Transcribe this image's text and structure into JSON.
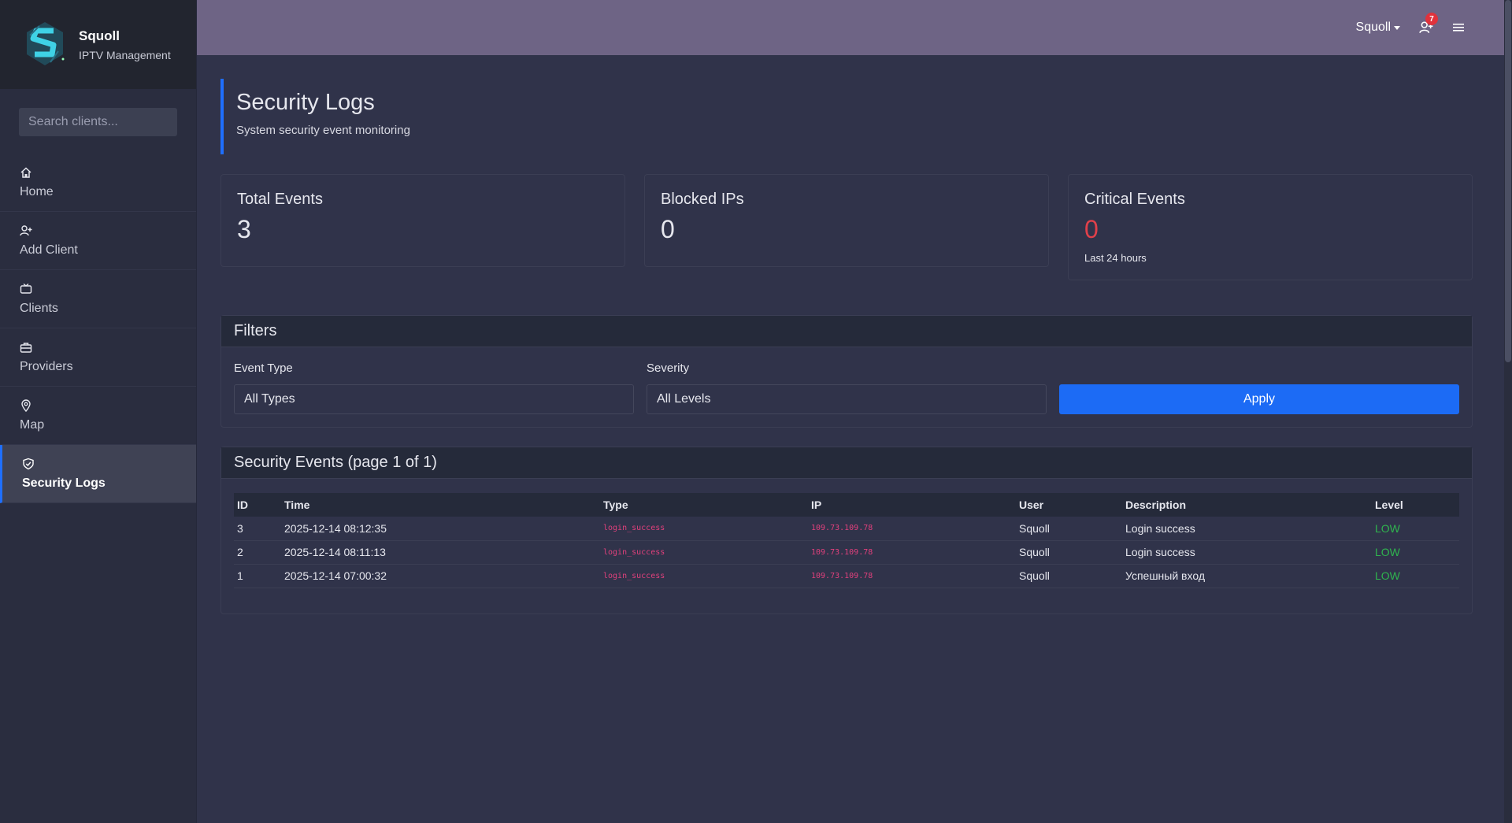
{
  "brand": {
    "name": "Squoll",
    "subtitle": "IPTV Management"
  },
  "sidebar": {
    "search_placeholder": "Search clients...",
    "items": [
      {
        "label": "Home",
        "icon": "home-icon"
      },
      {
        "label": "Add Client",
        "icon": "add-user-icon"
      },
      {
        "label": "Clients",
        "icon": "tv-icon"
      },
      {
        "label": "Providers",
        "icon": "briefcase-icon"
      },
      {
        "label": "Map",
        "icon": "map-pin-icon"
      },
      {
        "label": "Security Logs",
        "icon": "shield-icon",
        "active": true
      }
    ]
  },
  "topbar": {
    "user": "Squoll",
    "notifications": "7"
  },
  "page": {
    "title": "Security Logs",
    "subtitle": "System security event monitoring"
  },
  "stats": {
    "total": {
      "label": "Total Events",
      "value": "3"
    },
    "blocked": {
      "label": "Blocked IPs",
      "value": "0"
    },
    "critical": {
      "label": "Critical Events",
      "value": "0",
      "note": "Last 24 hours"
    }
  },
  "filters": {
    "title": "Filters",
    "event_type_label": "Event Type",
    "event_type_value": "All Types",
    "severity_label": "Severity",
    "severity_value": "All Levels",
    "apply": "Apply"
  },
  "events": {
    "title": "Security Events (page 1 of 1)",
    "columns": [
      "ID",
      "Time",
      "Type",
      "IP",
      "User",
      "Description",
      "Level"
    ],
    "rows": [
      [
        "3",
        "2025-12-14 08:12:35",
        "login_success",
        "109.73.109.78",
        "Squoll",
        "Login success",
        "LOW"
      ],
      [
        "2",
        "2025-12-14 08:11:13",
        "login_success",
        "109.73.109.78",
        "Squoll",
        "Login success",
        "LOW"
      ],
      [
        "1",
        "2025-12-14 07:00:32",
        "login_success",
        "109.73.109.78",
        "Squoll",
        "Успешный вход",
        "LOW"
      ]
    ]
  },
  "colors": {
    "accent": "#1f6fff",
    "topbar": "#6e6485",
    "danger": "#e0404a",
    "low": "#2fb44e"
  }
}
